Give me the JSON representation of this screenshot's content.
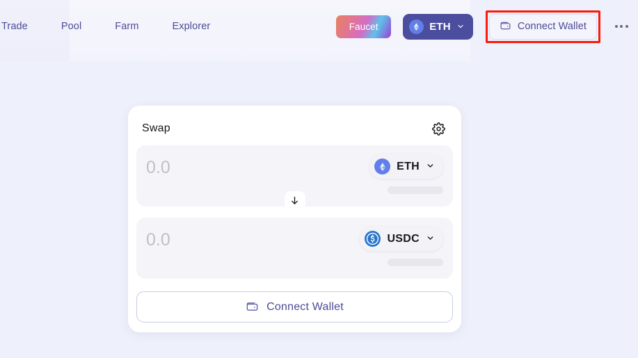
{
  "app": {
    "background_color": "#eef0fb",
    "accent_color": "#4b4b96",
    "highlight_color": "#f91a08"
  },
  "header": {
    "nav_items": [
      {
        "label": "Trade",
        "name": "nav-item-trade"
      },
      {
        "label": "Pool",
        "name": "nav-item-pool"
      },
      {
        "label": "Farm",
        "name": "nav-item-farm"
      },
      {
        "label": "Explorer",
        "name": "nav-item-explorer"
      }
    ],
    "faucet": {
      "label": "Faucet"
    },
    "network": {
      "label": "ETH",
      "icon": "ethereum-logo",
      "chevron": "chevron-down-icon"
    },
    "connect_wallet": {
      "label": "Connect Wallet",
      "icon": "wallet-icon"
    },
    "more": {
      "icon": "ellipsis-icon"
    }
  },
  "swap": {
    "title": "Swap",
    "settings_icon": "gear-icon",
    "direction_icon": "arrow-down-icon",
    "from": {
      "amount_value": "",
      "amount_placeholder": "0.0",
      "token_symbol": "ETH",
      "token_icon": "ethereum-logo",
      "chevron": "chevron-down-icon",
      "balance_loading": true
    },
    "to": {
      "amount_value": "",
      "amount_placeholder": "0.0",
      "token_symbol": "USDC",
      "token_icon": "usdc-logo",
      "chevron": "chevron-down-icon",
      "balance_loading": true
    },
    "action_button": {
      "label": "Connect Wallet",
      "icon": "wallet-icon"
    }
  }
}
